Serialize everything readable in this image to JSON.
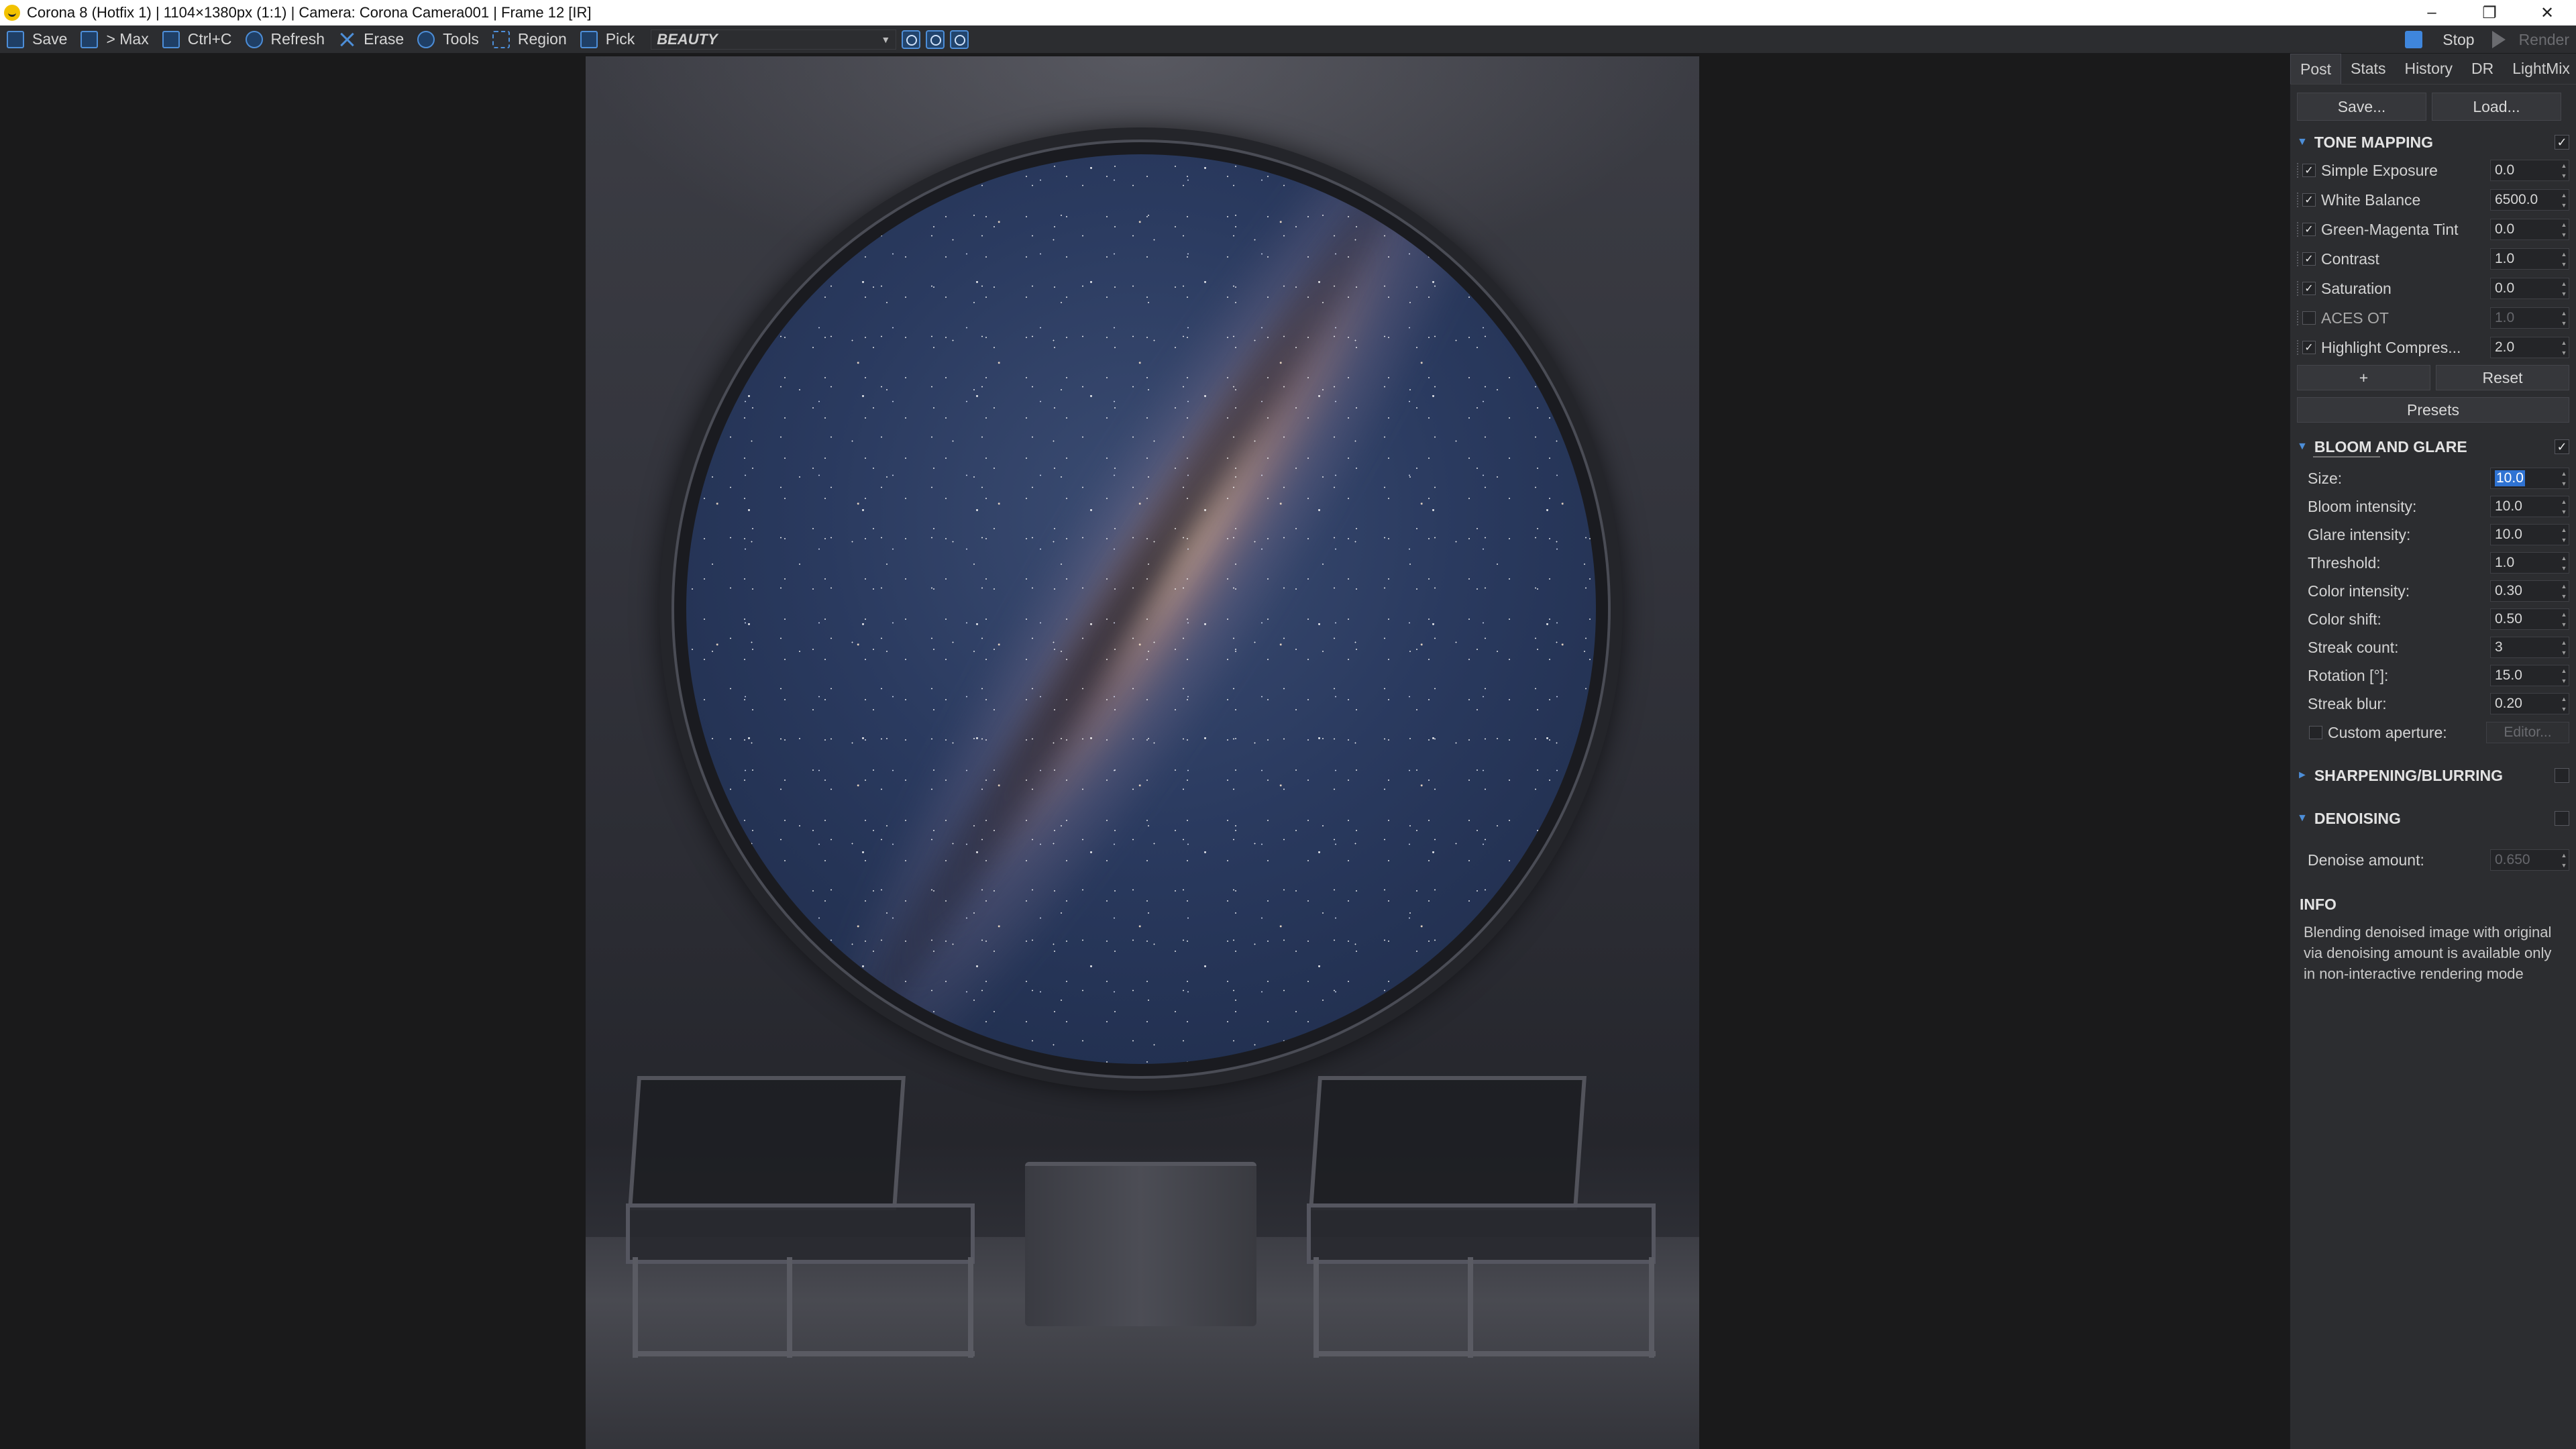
{
  "titlebar": {
    "title": "Corona 8 (Hotfix 1) | 1104×1380px (1:1) | Camera: Corona Camera001 | Frame 12 [IR]",
    "minimize": "–",
    "restore": "❐",
    "close": "✕"
  },
  "toolbar": {
    "save": "Save",
    "max": "> Max",
    "copy": "Ctrl+C",
    "refresh": "Refresh",
    "erase": "Erase",
    "tools": "Tools",
    "region": "Region",
    "pick": "Pick",
    "pass": "BEAUTY",
    "stop": "Stop",
    "render": "Render"
  },
  "panel": {
    "tabs": [
      "Post",
      "Stats",
      "History",
      "DR",
      "LightMix"
    ],
    "save_btn": "Save...",
    "load_btn": "Load...",
    "tone_mapping": {
      "title": "TONE MAPPING",
      "params": [
        {
          "label": "Simple Exposure",
          "value": "0.0",
          "checked": true
        },
        {
          "label": "White Balance",
          "value": "6500.0",
          "checked": true
        },
        {
          "label": "Green-Magenta Tint",
          "value": "0.0",
          "checked": true
        },
        {
          "label": "Contrast",
          "value": "1.0",
          "checked": true
        },
        {
          "label": "Saturation",
          "value": "0.0",
          "checked": true
        },
        {
          "label": "ACES OT",
          "value": "1.0",
          "checked": false
        },
        {
          "label": "Highlight Compres...",
          "value": "2.0",
          "checked": true
        }
      ],
      "add_btn": "+",
      "reset_btn": "Reset",
      "presets_btn": "Presets"
    },
    "bloom": {
      "title": "BLOOM AND GLARE",
      "params": [
        {
          "label": "Size:",
          "value": "10.0"
        },
        {
          "label": "Bloom intensity:",
          "value": "10.0"
        },
        {
          "label": "Glare intensity:",
          "value": "10.0"
        },
        {
          "label": "Threshold:",
          "value": "1.0"
        },
        {
          "label": "Color intensity:",
          "value": "0.30"
        },
        {
          "label": "Color shift:",
          "value": "0.50"
        },
        {
          "label": "Streak count:",
          "value": "3"
        },
        {
          "label": "Rotation [°]:",
          "value": "15.0"
        },
        {
          "label": "Streak blur:",
          "value": "0.20"
        }
      ],
      "custom_aperture": "Custom aperture:",
      "editor_btn": "Editor..."
    },
    "sharpening": {
      "title": "SHARPENING/BLURRING"
    },
    "denoising": {
      "title": "DENOISING",
      "amount_label": "Denoise amount:",
      "amount_value": "0.650"
    },
    "info": {
      "title": "INFO",
      "text": "Blending denoised image with original via denoising amount is available only in non-interactive rendering mode"
    }
  },
  "colors": {
    "accent": "#4d8ed8",
    "selection": "#2f73d3",
    "panel_bg": "#2c2d30",
    "viewport_bg": "#1a1a1b",
    "logo_red": "#d11a20"
  }
}
